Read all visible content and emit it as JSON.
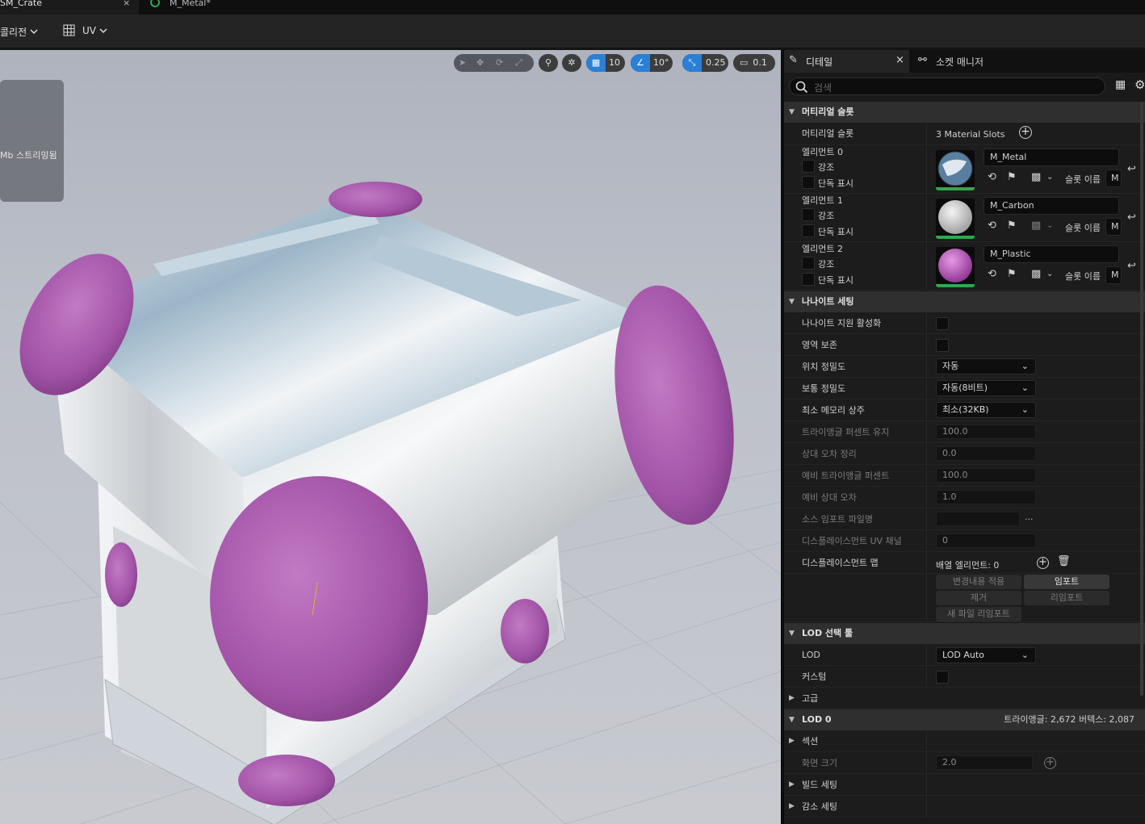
{
  "tabs": [
    {
      "label": "SM_Crate",
      "close": "×"
    },
    {
      "label": "M_Metal*"
    }
  ],
  "toolbar": {
    "collision_label": "콜리전",
    "uv_label": "UV"
  },
  "viewport": {
    "streaming_text": "Mb 스트리밍됨",
    "grid_snap": "10",
    "rotation_snap": "10°",
    "scale_snap": "0.25",
    "camera_speed": "0.1"
  },
  "details": {
    "tab_details": "디테일",
    "tab_close": "×",
    "tab_socket": "소켓 매니저",
    "search_placeholder": "검색",
    "material_section": "머티리얼 슬롯",
    "material_slots_label": "머티리얼 슬롯",
    "material_slots_value": "3 Material Slots",
    "highlight": "강조",
    "isolate": "단독 표시",
    "slot_name_label": "슬롯 이름",
    "slot_name_value": "M",
    "elements": [
      {
        "label": "엘리먼트 0",
        "material": "M_Metal"
      },
      {
        "label": "엘리먼트 1",
        "material": "M_Carbon"
      },
      {
        "label": "엘리먼트 2",
        "material": "M_Plastic"
      }
    ],
    "nanite_section": "나나이트 세팅",
    "nanite_rows": {
      "enable": "나나이트 지원 활성화",
      "preserve_area": "영역 보존",
      "position_precision": "위치 정밀도",
      "position_precision_value": "자동",
      "normal_precision": "보통 정밀도",
      "normal_precision_value": "자동(8비트)",
      "min_residency": "최소 메모리 상주",
      "min_residency_value": "최소(32KB)",
      "keep_triangle_percent": "트라이앵글 퍼센트 유지",
      "keep_triangle_percent_value": "100.0",
      "trim_relative_error": "상대 오차 정리",
      "trim_relative_error_value": "0.0",
      "fallback_triangle_percent": "예비 트라이앵글 퍼센트",
      "fallback_triangle_percent_value": "100.0",
      "fallback_relative_error": "예비 상대 오차",
      "fallback_relative_error_value": "1.0",
      "source_import_filename": "소스 임포트 파일명",
      "ellipsis": "...",
      "displacement_uv": "디스플레이스먼트 UV 채널",
      "displacement_uv_value": "0",
      "displacement_maps": "디스플레이스먼트 맵",
      "array_elements": "배열 엘리먼트: 0"
    },
    "nanite_buttons": {
      "apply": "변경내용 적용",
      "import": "임포트",
      "remove": "제거",
      "reimport": "리임포트",
      "reimport_new": "새 파일 리임포트"
    },
    "lod_picker_section": "LOD 선택 툴",
    "lod_label": "LOD",
    "lod_value": "LOD Auto",
    "custom_label": "커스텀",
    "advanced_label": "고급",
    "lod0_section": "LOD 0",
    "lod0_stats": "트라이앵글: 2,672   버텍스: 2,087",
    "sections_label": "섹션",
    "screen_size_label": "화면 크기",
    "screen_size_value": "2.0",
    "build_settings_label": "빌드 세팅",
    "reduction_settings_label": "감소 세팅"
  }
}
